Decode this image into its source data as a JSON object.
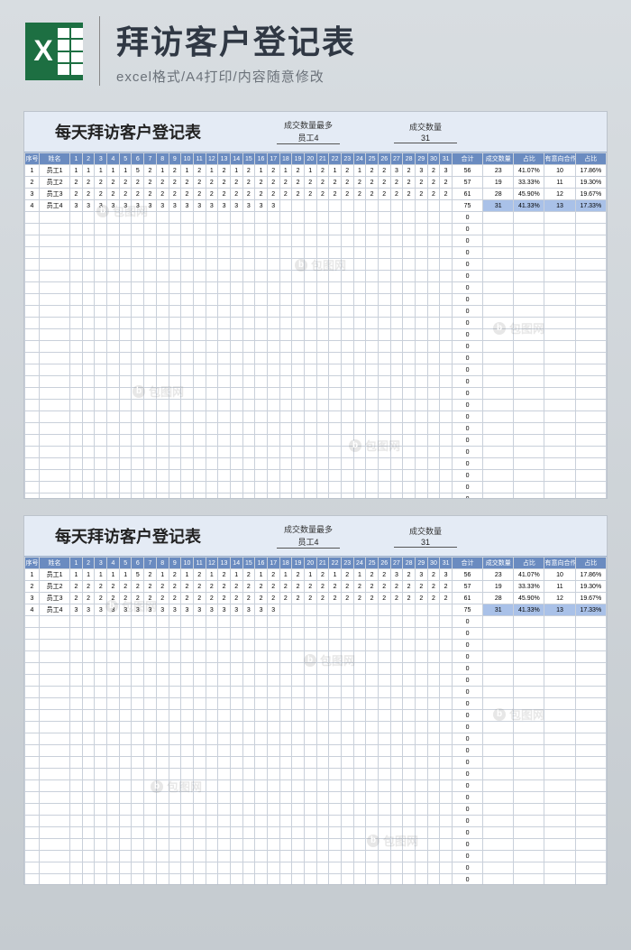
{
  "banner": {
    "title": "拜访客户登记表",
    "subtitle": "excel格式/A4打印/内容随意修改"
  },
  "document": {
    "title": "每天拜访客户登记表",
    "kpi": [
      {
        "label": "成交数量最多",
        "value": "员工4"
      },
      {
        "label": "成交数量",
        "value": "31"
      }
    ],
    "headers": {
      "idx": "序号",
      "name": "姓名",
      "days": [
        "1",
        "2",
        "3",
        "4",
        "5",
        "6",
        "7",
        "8",
        "9",
        "10",
        "11",
        "12",
        "13",
        "14",
        "15",
        "16",
        "17",
        "18",
        "19",
        "20",
        "21",
        "22",
        "23",
        "24",
        "25",
        "26",
        "27",
        "28",
        "29",
        "30",
        "31"
      ],
      "total": "合计",
      "deal": "成交数量",
      "pct1": "占比",
      "intent": "有意向合作",
      "pct2": "占比"
    },
    "rows": [
      {
        "idx": "1",
        "name": "员工1",
        "days": [
          "1",
          "1",
          "1",
          "1",
          "1",
          "5",
          "2",
          "1",
          "2",
          "1",
          "2",
          "1",
          "2",
          "1",
          "2",
          "1",
          "2",
          "1",
          "2",
          "1",
          "2",
          "1",
          "2",
          "1",
          "2",
          "2",
          "3",
          "2",
          "3",
          "2",
          "3"
        ],
        "total": "56",
        "deal": "23",
        "pct1": "41.07%",
        "intent": "10",
        "pct2": "17.86%"
      },
      {
        "idx": "2",
        "name": "员工2",
        "days": [
          "2",
          "2",
          "2",
          "2",
          "2",
          "2",
          "2",
          "2",
          "2",
          "2",
          "2",
          "2",
          "2",
          "2",
          "2",
          "2",
          "2",
          "2",
          "2",
          "2",
          "2",
          "2",
          "2",
          "2",
          "2",
          "2",
          "2",
          "2",
          "2",
          "2",
          "2"
        ],
        "total": "57",
        "deal": "19",
        "pct1": "33.33%",
        "intent": "11",
        "pct2": "19.30%"
      },
      {
        "idx": "3",
        "name": "员工3",
        "days": [
          "2",
          "2",
          "2",
          "2",
          "2",
          "2",
          "2",
          "2",
          "2",
          "2",
          "2",
          "2",
          "2",
          "2",
          "2",
          "2",
          "2",
          "2",
          "2",
          "2",
          "2",
          "2",
          "2",
          "2",
          "2",
          "2",
          "2",
          "2",
          "2",
          "2",
          "2"
        ],
        "total": "61",
        "deal": "28",
        "pct1": "45.90%",
        "intent": "12",
        "pct2": "19.67%"
      },
      {
        "idx": "4",
        "name": "员工4",
        "days": [
          "3",
          "3",
          "3",
          "3",
          "3",
          "3",
          "3",
          "3",
          "3",
          "3",
          "3",
          "3",
          "3",
          "3",
          "3",
          "3",
          "3",
          "",
          "",
          "",
          "",
          "",
          "",
          "",
          "",
          "",
          "",
          "",
          "",
          "",
          ""
        ],
        "total": "75",
        "deal": "31",
        "pct1": "41.33%",
        "intent": "13",
        "pct2": "17.33%"
      }
    ],
    "emptyTotal": "0"
  },
  "watermark": "包图网"
}
